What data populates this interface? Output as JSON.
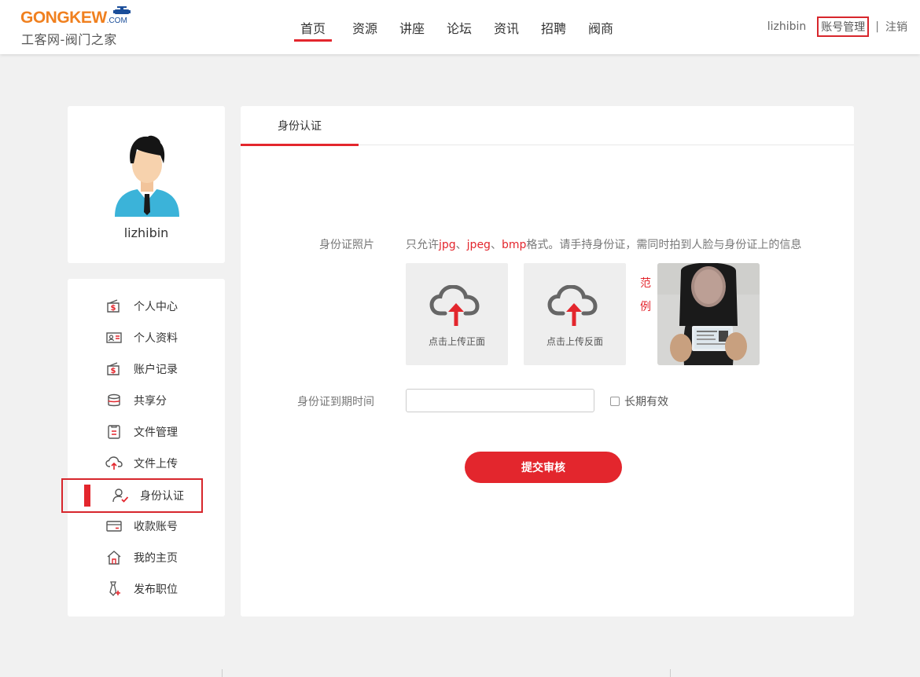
{
  "header": {
    "logo": {
      "part1": "GONGKEW",
      "part2": ".COM",
      "subtitle": "工客网-阀门之家"
    },
    "nav": [
      {
        "label": "首页",
        "active": true
      },
      {
        "label": "资源"
      },
      {
        "label": "讲座"
      },
      {
        "label": "论坛"
      },
      {
        "label": "资讯"
      },
      {
        "label": "招聘"
      },
      {
        "label": "阀商"
      }
    ],
    "username": "lizhibin",
    "account_link": "账号管理",
    "separator": "|",
    "logout": "注销"
  },
  "profile": {
    "name": "lizhibin",
    "avatar_icon": "user-avatar-icon"
  },
  "sidebar": {
    "items": [
      {
        "label": "个人中心",
        "icon": "wallet-icon"
      },
      {
        "label": "个人资料",
        "icon": "id-card-icon"
      },
      {
        "label": "账户记录",
        "icon": "dollar-record-icon"
      },
      {
        "label": "共享分",
        "icon": "coins-stack-icon"
      },
      {
        "label": "文件管理",
        "icon": "document-icon"
      },
      {
        "label": "文件上传",
        "icon": "cloud-upload-icon"
      },
      {
        "label": "身份认证",
        "icon": "user-check-icon",
        "active": true
      },
      {
        "label": "收款账号",
        "icon": "card-icon"
      },
      {
        "label": "我的主页",
        "icon": "home-icon"
      },
      {
        "label": "发布职位",
        "icon": "tie-add-icon"
      }
    ]
  },
  "main": {
    "tab": "身份认证",
    "id_photo_label": "身份证照片",
    "hint": {
      "p1": "只允许",
      "jpg": "jpg",
      "sep1": "、",
      "jpeg": "jpeg",
      "sep2": "、",
      "bmp": "bmp",
      "p2": "格式。请手持身份证，需同时拍到人脸与身份证上的信息"
    },
    "upload_front": "点击上传正面",
    "upload_back": "点击上传反面",
    "sample_label_1": "范",
    "sample_label_2": "例",
    "expiry_label": "身份证到期时间",
    "expiry_value": "",
    "long_term_label": "长期有效",
    "submit": "提交审核"
  },
  "colors": {
    "accent": "#e3262d",
    "background": "#f1f1f1"
  }
}
